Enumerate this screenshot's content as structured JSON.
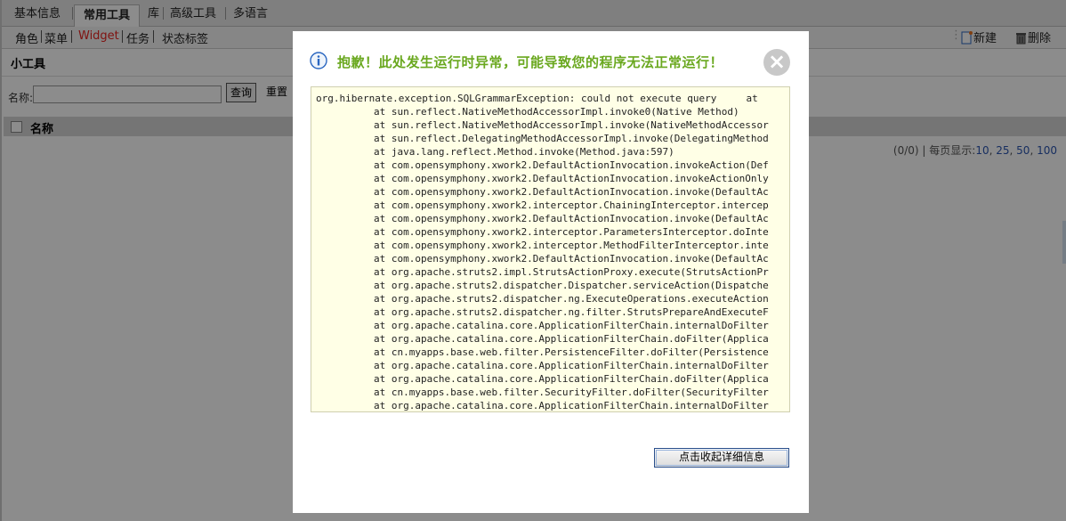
{
  "topnav": {
    "tabs": [
      "基本信息",
      "常用工具",
      "库",
      "高级工具",
      "多语言"
    ],
    "active_index": 1
  },
  "subnav": {
    "items": [
      "角色",
      "菜单",
      "Widget",
      "任务",
      "状态标签"
    ],
    "active_index": 2
  },
  "toolbar": {
    "new_label": "新建",
    "delete_label": "删除"
  },
  "panel": {
    "title": "小工具"
  },
  "search": {
    "label": "名称:",
    "value": "",
    "query_label": "查询",
    "reset_label": "重置"
  },
  "grid": {
    "column_name": "名称"
  },
  "pager": {
    "count": "(0/0)",
    "sep": "|",
    "per_page_label": "每页显示:",
    "options": [
      "10",
      "25",
      "50",
      "100"
    ]
  },
  "dialog": {
    "title": "抱歉！此处发生运行时异常，可能导致您的程序无法正常运行！",
    "close_symbol": "×",
    "trace_first": "org.hibernate.exception.SQLGrammarException: could not execute query     at",
    "trace_lines": [
      "at sun.reflect.NativeMethodAccessorImpl.invoke0(Native Method)",
      "at sun.reflect.NativeMethodAccessorImpl.invoke(NativeMethodAccessor",
      "at sun.reflect.DelegatingMethodAccessorImpl.invoke(DelegatingMethod",
      "at java.lang.reflect.Method.invoke(Method.java:597)",
      "at com.opensymphony.xwork2.DefaultActionInvocation.invokeAction(Def",
      "at com.opensymphony.xwork2.DefaultActionInvocation.invokeActionOnly",
      "at com.opensymphony.xwork2.DefaultActionInvocation.invoke(DefaultAc",
      "at com.opensymphony.xwork2.interceptor.ChainingInterceptor.intercep",
      "at com.opensymphony.xwork2.DefaultActionInvocation.invoke(DefaultAc",
      "at com.opensymphony.xwork2.interceptor.ParametersInterceptor.doInte",
      "at com.opensymphony.xwork2.interceptor.MethodFilterInterceptor.inte",
      "at com.opensymphony.xwork2.DefaultActionInvocation.invoke(DefaultAc",
      "at org.apache.struts2.impl.StrutsActionProxy.execute(StrutsActionPr",
      "at org.apache.struts2.dispatcher.Dispatcher.serviceAction(Dispatche",
      "at org.apache.struts2.dispatcher.ng.ExecuteOperations.executeAction",
      "at org.apache.struts2.dispatcher.ng.filter.StrutsPrepareAndExecuteF",
      "at org.apache.catalina.core.ApplicationFilterChain.internalDoFilter",
      "at org.apache.catalina.core.ApplicationFilterChain.doFilter(Applica",
      "at cn.myapps.base.web.filter.PersistenceFilter.doFilter(Persistence",
      "at org.apache.catalina.core.ApplicationFilterChain.internalDoFilter",
      "at org.apache.catalina.core.ApplicationFilterChain.doFilter(Applica",
      "at cn.myapps.base.web.filter.SecurityFilter.doFilter(SecurityFilter",
      "at org.apache.catalina.core.ApplicationFilterChain.internalDoFilter"
    ],
    "collapse_label": "点击收起详细信息"
  },
  "colors": {
    "title_green": "#6aa81f",
    "widget_red": "#e8231f",
    "trace_bg": "#ffffe6",
    "overlay": "rgba(0,0,0,0.45)"
  },
  "icons": [
    "new-doc-icon",
    "trash-icon",
    "info-icon",
    "close-icon"
  ]
}
